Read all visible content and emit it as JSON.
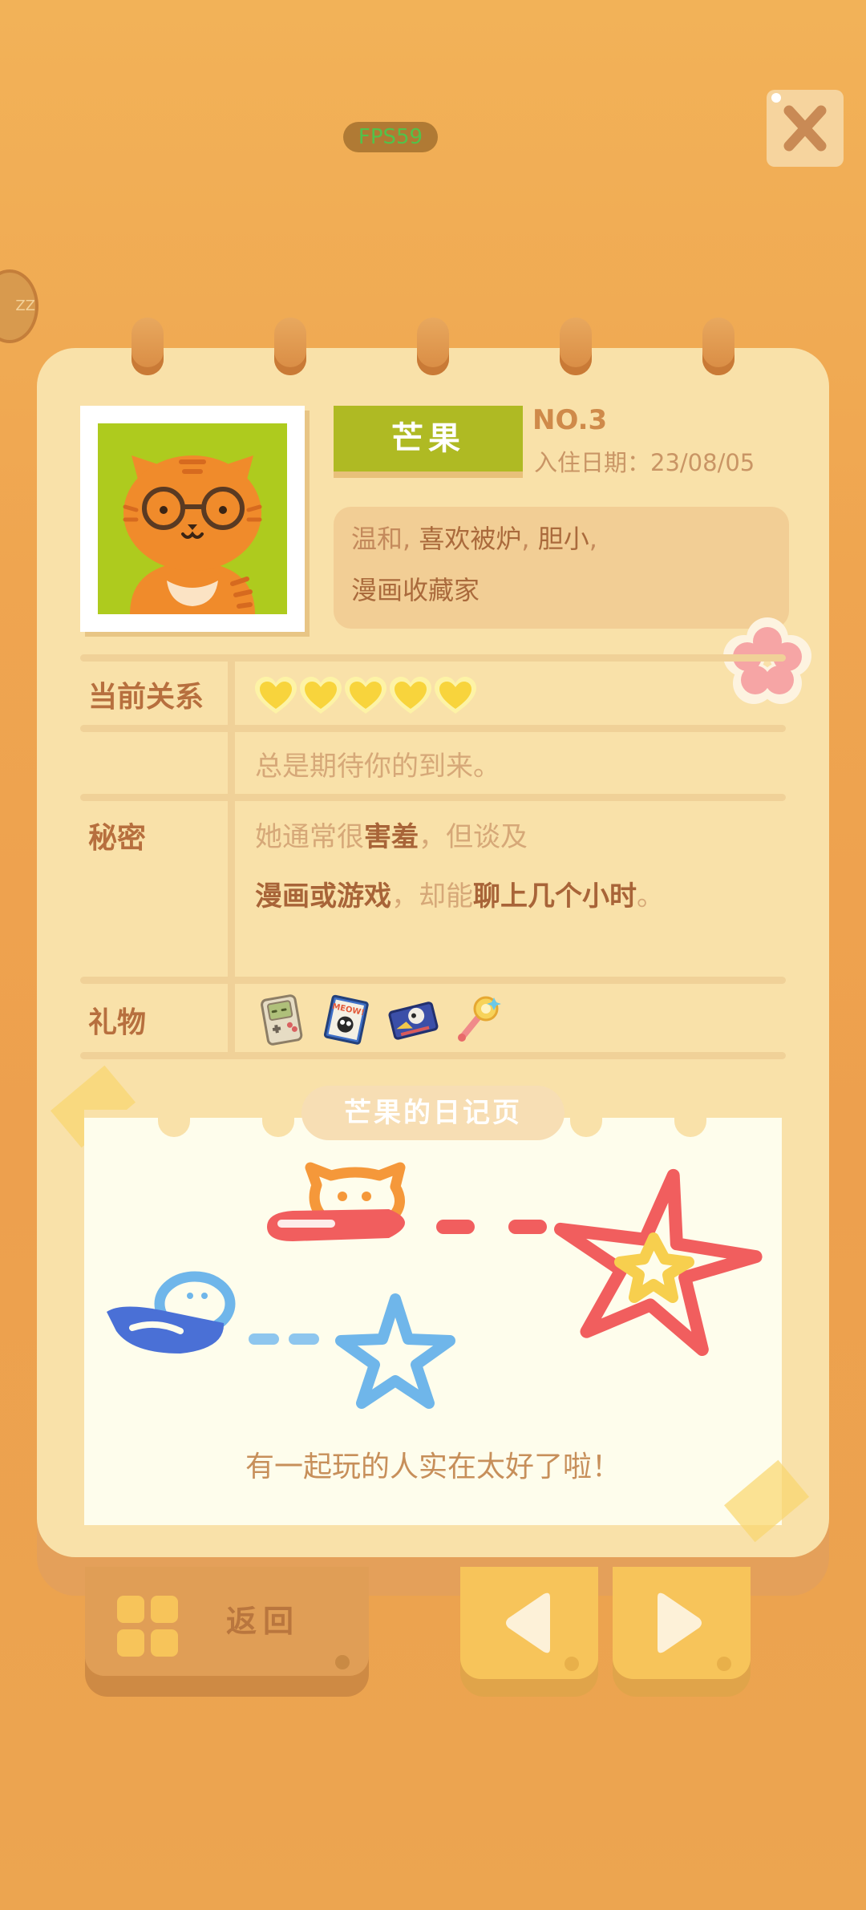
{
  "overlay": {
    "fps": "FPS59",
    "side_badge": "ZZ"
  },
  "profile": {
    "name": "芒果",
    "number": "NO.3",
    "checkin_date": "入住日期：23/08/05",
    "traits": [
      {
        "text": "温和, ",
        "strong": false
      },
      {
        "text": "喜欢被炉",
        "strong": true
      },
      {
        "text": ", ",
        "strong": false
      },
      {
        "text": "胆小",
        "strong": true
      },
      {
        "text": ",",
        "strong": false
      },
      {
        "text": "漫画收藏家",
        "strong": true,
        "newline": true
      }
    ]
  },
  "relation": {
    "label": "当前关系",
    "hearts_filled": 5,
    "hearts_total": 5,
    "description": "总是期待你的到来。"
  },
  "secret": {
    "label": "秘密",
    "line1": [
      {
        "text": "她通常很",
        "strong": false
      },
      {
        "text": "害羞",
        "strong": true
      },
      {
        "text": "，但谈及",
        "strong": false
      }
    ],
    "line2": [
      {
        "text": "漫画或游戏",
        "strong": true
      },
      {
        "text": "，却能",
        "strong": false
      },
      {
        "text": "聊上几个小时",
        "strong": true
      },
      {
        "text": "。",
        "strong": false
      }
    ]
  },
  "gifts": {
    "label": "礼物",
    "items": [
      "game-console-gift",
      "manga-meow-gift",
      "game-box-gift",
      "magic-wand-gift"
    ],
    "manga_cover_text": "MEOW!"
  },
  "diary": {
    "title": "芒果的日记页",
    "caption": "有一起玩的人实在太好了啦！"
  },
  "footer": {
    "back_label": "返回"
  },
  "colors": {
    "accent_green": "#AFBA23",
    "heart": "#F8D43C",
    "text_brown": "#B76F3E",
    "paper": "#F9E1A9"
  }
}
